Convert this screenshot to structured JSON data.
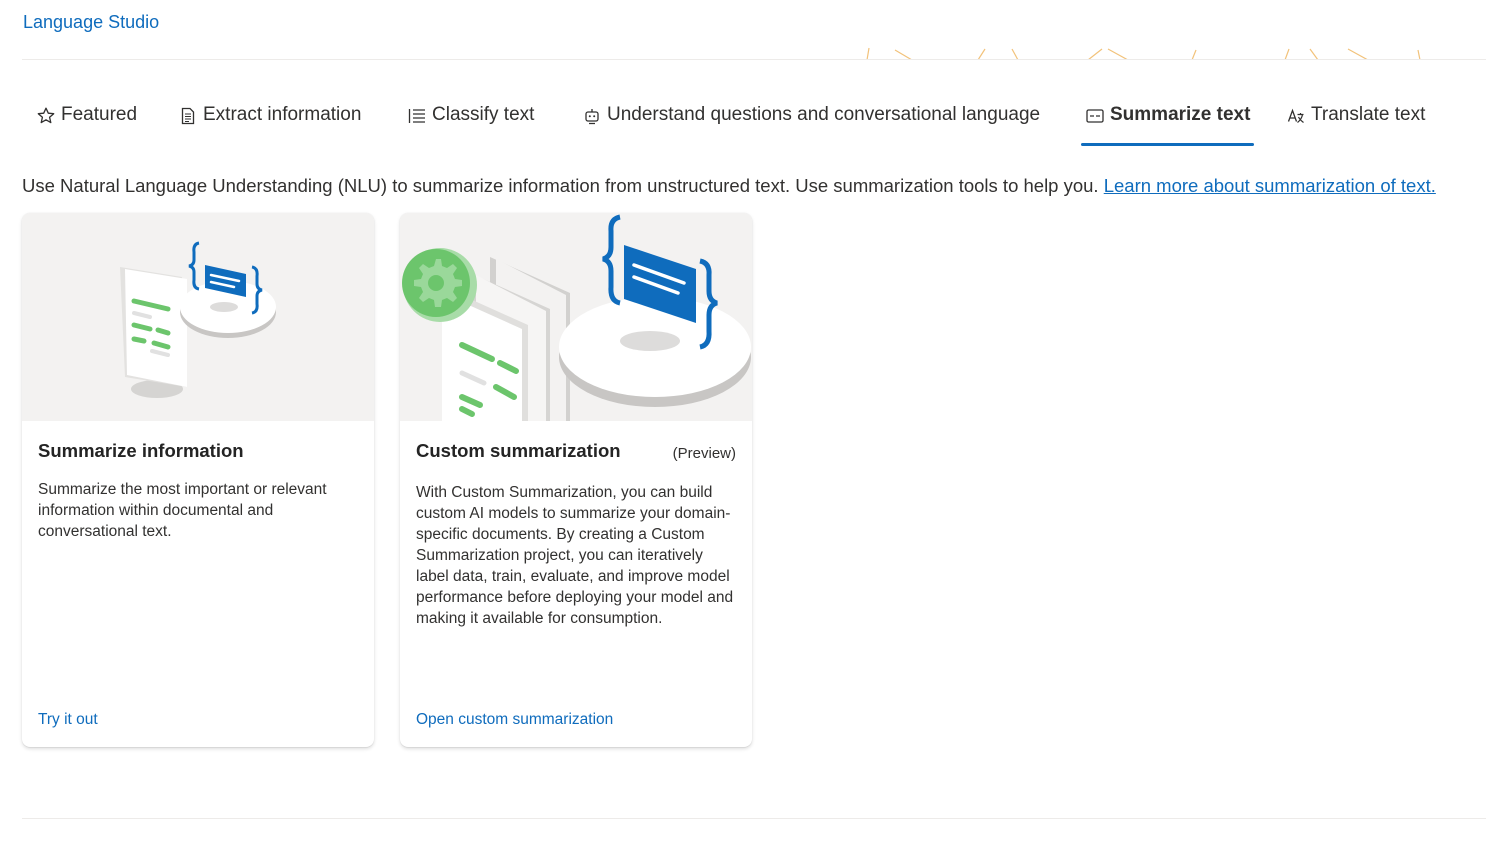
{
  "header": {
    "brand": "Language Studio"
  },
  "tabs": [
    {
      "label": "Featured",
      "icon": "star-icon",
      "active": false
    },
    {
      "label": "Extract information",
      "icon": "document-icon",
      "active": false
    },
    {
      "label": "Classify text",
      "icon": "list-icon",
      "active": false
    },
    {
      "label": "Understand questions and conversational language",
      "icon": "bot-icon",
      "active": false
    },
    {
      "label": "Summarize text",
      "icon": "summary-icon",
      "active": true
    },
    {
      "label": "Translate text",
      "icon": "translate-icon",
      "active": false
    }
  ],
  "intro": {
    "text": "Use Natural Language Understanding (NLU) to summarize information from unstructured text. Use summarization tools to help you. ",
    "link": "Learn more about summarization of text."
  },
  "cards": [
    {
      "title": "Summarize information",
      "badge": "",
      "body": "Summarize the most important or relevant information within documental and conversational text.",
      "link": "Try it out",
      "image_icon": "summarize-illustration"
    },
    {
      "title": "Custom summarization",
      "badge": "(Preview)",
      "body": "With Custom Summarization, you can build custom AI models to summarize your domain-specific documents. By creating a Custom Summarization project, you can iteratively label data, train, evaluate, and improve model performance before deploying your model and making it available for consumption.",
      "link": "Open custom summarization",
      "image_icon": "custom-summarization-illustration"
    }
  ],
  "colors": {
    "accent": "#0f6cbd",
    "card_image_bg": "#f3f2f1",
    "green": "#6cc56c",
    "header_deco": "#f2c27a"
  }
}
